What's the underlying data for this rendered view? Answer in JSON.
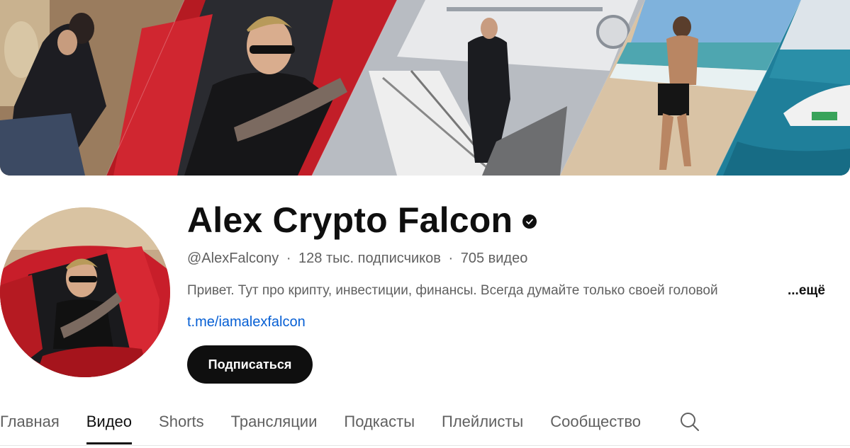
{
  "channel": {
    "name": "Alex Crypto Falcon",
    "handle": "@AlexFalcony",
    "subscribers": "128 тыс. подписчиков",
    "videos": "705 видео",
    "separator": "·",
    "description": "Привет. Тут про крипту, инвестиции, финансы. Всегда думайте только своей головой",
    "more_label": "...ещё",
    "link": "t.me/iamalexfalcon",
    "subscribe_label": "Подписаться",
    "verified_icon": "verified-check-icon"
  },
  "tabs": [
    {
      "label": "Главная",
      "active": false
    },
    {
      "label": "Видео",
      "active": true
    },
    {
      "label": "Shorts",
      "active": false
    },
    {
      "label": "Трансляции",
      "active": false
    },
    {
      "label": "Подкасты",
      "active": false
    },
    {
      "label": "Плейлисты",
      "active": false
    },
    {
      "label": "Сообщество",
      "active": false
    }
  ],
  "search_icon": "search-icon",
  "colors": {
    "text_primary": "#0f0f0f",
    "text_secondary": "#606060",
    "link": "#065fd4",
    "subscribe_bg": "#0f0f0f",
    "car_red": "#c8202a"
  }
}
